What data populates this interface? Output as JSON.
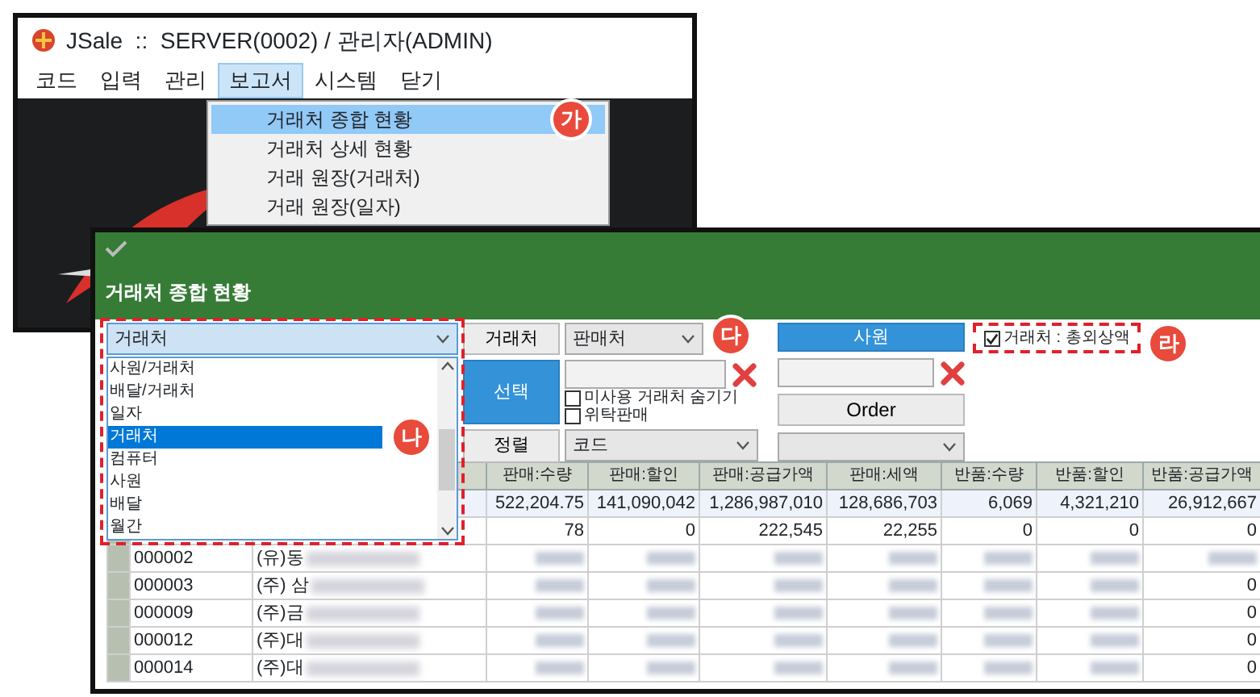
{
  "back_window": {
    "title": "JSale  ::  SERVER(0002) / 관리자(ADMIN)",
    "menu": [
      {
        "label": "코드",
        "selected": false
      },
      {
        "label": "입력",
        "selected": false
      },
      {
        "label": "관리",
        "selected": false
      },
      {
        "label": "보고서",
        "selected": true
      },
      {
        "label": "시스템",
        "selected": false
      },
      {
        "label": "닫기",
        "selected": false
      }
    ],
    "dropdown": {
      "callout": "가",
      "items": [
        {
          "label": "거래처 종합 현황",
          "selected": true
        },
        {
          "label": "거래처 상세 현황",
          "selected": false
        },
        {
          "label": "거래 원장(거래처)",
          "selected": false
        },
        {
          "label": "거래 원장(일자)",
          "selected": false
        }
      ]
    }
  },
  "report_window": {
    "title": "거래처 종합 현황",
    "group_by": {
      "value": "거래처",
      "callout": "나",
      "options": [
        {
          "label": "사원/거래처",
          "selected": false
        },
        {
          "label": "배달/거래처",
          "selected": false
        },
        {
          "label": "일자",
          "selected": false
        },
        {
          "label": "거래처",
          "selected": true
        },
        {
          "label": "컴퓨터",
          "selected": false
        },
        {
          "label": "사원",
          "selected": false
        },
        {
          "label": "배달",
          "selected": false
        },
        {
          "label": "월간",
          "selected": false
        }
      ]
    },
    "filters": {
      "callout": "다",
      "customer_label": "거래처",
      "customer_type": "판매처",
      "select_button": "선택",
      "sort_label": "정렬",
      "sort_value": "코드",
      "checkboxes": [
        {
          "label": "미사용 거래처 숨기기",
          "checked": false
        },
        {
          "label": "위탁판매",
          "checked": false
        }
      ]
    },
    "staff": {
      "button": "사원",
      "order_button": "Order"
    },
    "balance_option": {
      "label": "거래처 : 총외상액",
      "checked": true,
      "callout": "라"
    },
    "table": {
      "columns": [
        "판매:수량",
        "판매:할인",
        "판매:공급가액",
        "판매:세액",
        "반품:수량",
        "반품:할인",
        "반품:공급가액"
      ],
      "rows": [
        {
          "kind": "total",
          "cells": [
            {
              "masked": false,
              "text": "522,204.75"
            },
            {
              "masked": false,
              "text": "141,090,042"
            },
            {
              "masked": false,
              "text": "1,286,987,010"
            },
            {
              "masked": false,
              "text": "128,686,703"
            },
            {
              "masked": false,
              "text": "6,069"
            },
            {
              "masked": false,
              "text": "4,321,210"
            },
            {
              "masked": false,
              "text": "26,912,667"
            }
          ]
        },
        {
          "kind": "data",
          "cells": [
            {
              "masked": false,
              "text": "78"
            },
            {
              "masked": false,
              "text": "0"
            },
            {
              "masked": false,
              "text": "222,545"
            },
            {
              "masked": false,
              "text": "22,255"
            },
            {
              "masked": false,
              "text": "0"
            },
            {
              "masked": false,
              "text": "0"
            },
            {
              "masked": false,
              "text": "0"
            }
          ]
        },
        {
          "kind": "data",
          "code": "000002",
          "name": "(유)동",
          "cells": [
            {
              "masked": true
            },
            {
              "masked": true
            },
            {
              "masked": true
            },
            {
              "masked": true
            },
            {
              "masked": true
            },
            {
              "masked": true
            },
            {
              "masked": true
            }
          ]
        },
        {
          "kind": "data",
          "code": "000003",
          "name": "(주) 삼",
          "cells": [
            {
              "masked": true
            },
            {
              "masked": true
            },
            {
              "masked": true
            },
            {
              "masked": true
            },
            {
              "masked": true
            },
            {
              "masked": true
            },
            {
              "masked": false,
              "text": "0"
            }
          ]
        },
        {
          "kind": "data",
          "code": "000009",
          "name": "(주)금",
          "cells": [
            {
              "masked": true
            },
            {
              "masked": true
            },
            {
              "masked": true
            },
            {
              "masked": true
            },
            {
              "masked": true
            },
            {
              "masked": true
            },
            {
              "masked": false,
              "text": "0"
            }
          ]
        },
        {
          "kind": "data",
          "code": "000012",
          "name": "(주)대",
          "cells": [
            {
              "masked": true
            },
            {
              "masked": true
            },
            {
              "masked": true
            },
            {
              "masked": true
            },
            {
              "masked": true
            },
            {
              "masked": true
            },
            {
              "masked": false,
              "text": "0"
            }
          ]
        },
        {
          "kind": "data",
          "code": "000014",
          "name": "(주)대",
          "cells": [
            {
              "masked": true
            },
            {
              "masked": true
            },
            {
              "masked": true
            },
            {
              "masked": true
            },
            {
              "masked": true
            },
            {
              "masked": true
            },
            {
              "masked": false,
              "text": "0"
            }
          ]
        }
      ]
    }
  }
}
